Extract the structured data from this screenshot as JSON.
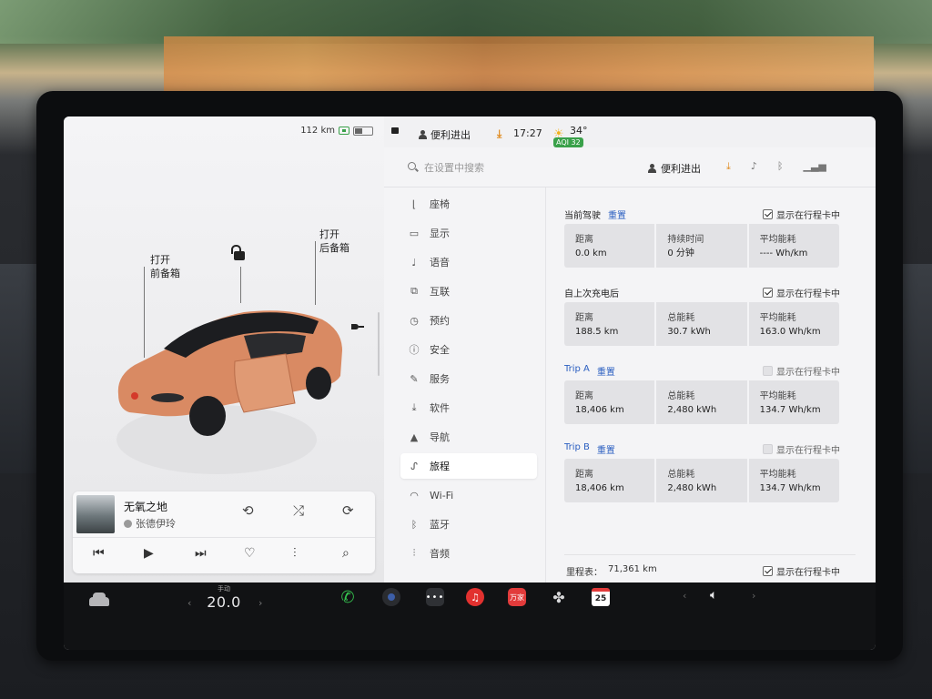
{
  "car": {
    "range": "112 km",
    "frunk_label": [
      "打开",
      "前备箱"
    ],
    "trunk_label": [
      "打开",
      "后备箱"
    ],
    "paint_color": "#d98a63"
  },
  "media": {
    "title": "无氧之地",
    "artist": "张德伊玲"
  },
  "status_bar": {
    "profile": "便利进出",
    "time": "17:27",
    "temperature": "34°",
    "aqi": "AQI 32"
  },
  "settings": {
    "search_placeholder": "在设置中搜索",
    "profile": "便利进出",
    "menu": [
      {
        "label": "座椅",
        "icon": "seat-icon",
        "glyph": "⌊"
      },
      {
        "label": "显示",
        "icon": "display-icon",
        "glyph": "▭"
      },
      {
        "label": "语音",
        "icon": "microphone-icon",
        "glyph": "♩"
      },
      {
        "label": "互联",
        "icon": "connectivity-icon",
        "glyph": "⧉"
      },
      {
        "label": "预约",
        "icon": "clock-icon",
        "glyph": "◷"
      },
      {
        "label": "安全",
        "icon": "safety-icon",
        "glyph": "ⓘ"
      },
      {
        "label": "服务",
        "icon": "wrench-icon",
        "glyph": "✎"
      },
      {
        "label": "软件",
        "icon": "download-icon",
        "glyph": "⤓"
      },
      {
        "label": "导航",
        "icon": "navigation-icon",
        "glyph": "▲"
      },
      {
        "label": "旅程",
        "icon": "trips-icon",
        "glyph": "ᔑ"
      },
      {
        "label": "Wi-Fi",
        "icon": "wifi-icon",
        "glyph": "◠"
      },
      {
        "label": "蓝牙",
        "icon": "bluetooth-icon",
        "glyph": "ᛒ"
      },
      {
        "label": "音频",
        "icon": "audio-icon",
        "glyph": "⫶"
      }
    ],
    "active_menu": "旅程"
  },
  "trips": {
    "show_label": "显示在行程卡中",
    "reset_label": "重置",
    "current_drive": {
      "title": "当前驾驶",
      "show_checked": true,
      "stats": [
        {
          "label": "距离",
          "value": "0.0 km"
        },
        {
          "label": "持续时间",
          "value": "0 分钟"
        },
        {
          "label": "平均能耗",
          "value": "---- Wh/km"
        }
      ]
    },
    "since_last_charge": {
      "title": "自上次充电后",
      "show_checked": true,
      "stats": [
        {
          "label": "距离",
          "value": "188.5 km"
        },
        {
          "label": "总能耗",
          "value": "30.7 kWh"
        },
        {
          "label": "平均能耗",
          "value": "163.0 Wh/km"
        }
      ]
    },
    "trip_a": {
      "title": "Trip A",
      "show_checked": false,
      "stats": [
        {
          "label": "距离",
          "value": "18,406 km"
        },
        {
          "label": "总能耗",
          "value": "2,480 kWh"
        },
        {
          "label": "平均能耗",
          "value": "134.7 Wh/km"
        }
      ]
    },
    "trip_b": {
      "title": "Trip B",
      "show_checked": false,
      "stats": [
        {
          "label": "距离",
          "value": "18,406 km"
        },
        {
          "label": "总能耗",
          "value": "2,480 kWh"
        },
        {
          "label": "平均能耗",
          "value": "134.7 Wh/km"
        }
      ]
    },
    "odometer": {
      "label": "里程表：",
      "value": "71,361 km",
      "show_checked": true
    }
  },
  "taskbar": {
    "climate_mode": "手动",
    "temperature": "20.0",
    "calendar_day": "25",
    "red_app_text": "万家"
  }
}
